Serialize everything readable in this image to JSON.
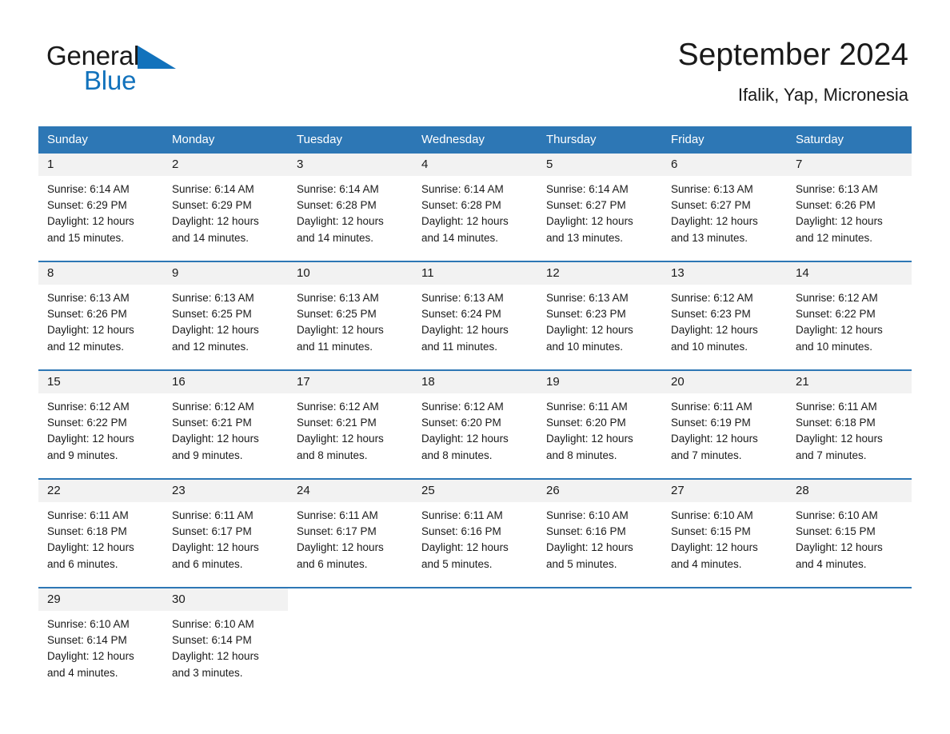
{
  "brand": {
    "name_part1": "General",
    "name_part2": "Blue",
    "logo_color": "#1272bc"
  },
  "header": {
    "title": "September 2024",
    "subtitle": "Ifalik, Yap, Micronesia"
  },
  "theme": {
    "header_blue": "#2d77b5",
    "daynum_bg": "#f2f2f2",
    "text": "#1a1a1a"
  },
  "weekday_headers": [
    "Sunday",
    "Monday",
    "Tuesday",
    "Wednesday",
    "Thursday",
    "Friday",
    "Saturday"
  ],
  "weeks": [
    [
      {
        "day": "1",
        "sunrise": "Sunrise: 6:14 AM",
        "sunset": "Sunset: 6:29 PM",
        "daylight_line1": "Daylight: 12 hours",
        "daylight_line2": "and 15 minutes."
      },
      {
        "day": "2",
        "sunrise": "Sunrise: 6:14 AM",
        "sunset": "Sunset: 6:29 PM",
        "daylight_line1": "Daylight: 12 hours",
        "daylight_line2": "and 14 minutes."
      },
      {
        "day": "3",
        "sunrise": "Sunrise: 6:14 AM",
        "sunset": "Sunset: 6:28 PM",
        "daylight_line1": "Daylight: 12 hours",
        "daylight_line2": "and 14 minutes."
      },
      {
        "day": "4",
        "sunrise": "Sunrise: 6:14 AM",
        "sunset": "Sunset: 6:28 PM",
        "daylight_line1": "Daylight: 12 hours",
        "daylight_line2": "and 14 minutes."
      },
      {
        "day": "5",
        "sunrise": "Sunrise: 6:14 AM",
        "sunset": "Sunset: 6:27 PM",
        "daylight_line1": "Daylight: 12 hours",
        "daylight_line2": "and 13 minutes."
      },
      {
        "day": "6",
        "sunrise": "Sunrise: 6:13 AM",
        "sunset": "Sunset: 6:27 PM",
        "daylight_line1": "Daylight: 12 hours",
        "daylight_line2": "and 13 minutes."
      },
      {
        "day": "7",
        "sunrise": "Sunrise: 6:13 AM",
        "sunset": "Sunset: 6:26 PM",
        "daylight_line1": "Daylight: 12 hours",
        "daylight_line2": "and 12 minutes."
      }
    ],
    [
      {
        "day": "8",
        "sunrise": "Sunrise: 6:13 AM",
        "sunset": "Sunset: 6:26 PM",
        "daylight_line1": "Daylight: 12 hours",
        "daylight_line2": "and 12 minutes."
      },
      {
        "day": "9",
        "sunrise": "Sunrise: 6:13 AM",
        "sunset": "Sunset: 6:25 PM",
        "daylight_line1": "Daylight: 12 hours",
        "daylight_line2": "and 12 minutes."
      },
      {
        "day": "10",
        "sunrise": "Sunrise: 6:13 AM",
        "sunset": "Sunset: 6:25 PM",
        "daylight_line1": "Daylight: 12 hours",
        "daylight_line2": "and 11 minutes."
      },
      {
        "day": "11",
        "sunrise": "Sunrise: 6:13 AM",
        "sunset": "Sunset: 6:24 PM",
        "daylight_line1": "Daylight: 12 hours",
        "daylight_line2": "and 11 minutes."
      },
      {
        "day": "12",
        "sunrise": "Sunrise: 6:13 AM",
        "sunset": "Sunset: 6:23 PM",
        "daylight_line1": "Daylight: 12 hours",
        "daylight_line2": "and 10 minutes."
      },
      {
        "day": "13",
        "sunrise": "Sunrise: 6:12 AM",
        "sunset": "Sunset: 6:23 PM",
        "daylight_line1": "Daylight: 12 hours",
        "daylight_line2": "and 10 minutes."
      },
      {
        "day": "14",
        "sunrise": "Sunrise: 6:12 AM",
        "sunset": "Sunset: 6:22 PM",
        "daylight_line1": "Daylight: 12 hours",
        "daylight_line2": "and 10 minutes."
      }
    ],
    [
      {
        "day": "15",
        "sunrise": "Sunrise: 6:12 AM",
        "sunset": "Sunset: 6:22 PM",
        "daylight_line1": "Daylight: 12 hours",
        "daylight_line2": "and 9 minutes."
      },
      {
        "day": "16",
        "sunrise": "Sunrise: 6:12 AM",
        "sunset": "Sunset: 6:21 PM",
        "daylight_line1": "Daylight: 12 hours",
        "daylight_line2": "and 9 minutes."
      },
      {
        "day": "17",
        "sunrise": "Sunrise: 6:12 AM",
        "sunset": "Sunset: 6:21 PM",
        "daylight_line1": "Daylight: 12 hours",
        "daylight_line2": "and 8 minutes."
      },
      {
        "day": "18",
        "sunrise": "Sunrise: 6:12 AM",
        "sunset": "Sunset: 6:20 PM",
        "daylight_line1": "Daylight: 12 hours",
        "daylight_line2": "and 8 minutes."
      },
      {
        "day": "19",
        "sunrise": "Sunrise: 6:11 AM",
        "sunset": "Sunset: 6:20 PM",
        "daylight_line1": "Daylight: 12 hours",
        "daylight_line2": "and 8 minutes."
      },
      {
        "day": "20",
        "sunrise": "Sunrise: 6:11 AM",
        "sunset": "Sunset: 6:19 PM",
        "daylight_line1": "Daylight: 12 hours",
        "daylight_line2": "and 7 minutes."
      },
      {
        "day": "21",
        "sunrise": "Sunrise: 6:11 AM",
        "sunset": "Sunset: 6:18 PM",
        "daylight_line1": "Daylight: 12 hours",
        "daylight_line2": "and 7 minutes."
      }
    ],
    [
      {
        "day": "22",
        "sunrise": "Sunrise: 6:11 AM",
        "sunset": "Sunset: 6:18 PM",
        "daylight_line1": "Daylight: 12 hours",
        "daylight_line2": "and 6 minutes."
      },
      {
        "day": "23",
        "sunrise": "Sunrise: 6:11 AM",
        "sunset": "Sunset: 6:17 PM",
        "daylight_line1": "Daylight: 12 hours",
        "daylight_line2": "and 6 minutes."
      },
      {
        "day": "24",
        "sunrise": "Sunrise: 6:11 AM",
        "sunset": "Sunset: 6:17 PM",
        "daylight_line1": "Daylight: 12 hours",
        "daylight_line2": "and 6 minutes."
      },
      {
        "day": "25",
        "sunrise": "Sunrise: 6:11 AM",
        "sunset": "Sunset: 6:16 PM",
        "daylight_line1": "Daylight: 12 hours",
        "daylight_line2": "and 5 minutes."
      },
      {
        "day": "26",
        "sunrise": "Sunrise: 6:10 AM",
        "sunset": "Sunset: 6:16 PM",
        "daylight_line1": "Daylight: 12 hours",
        "daylight_line2": "and 5 minutes."
      },
      {
        "day": "27",
        "sunrise": "Sunrise: 6:10 AM",
        "sunset": "Sunset: 6:15 PM",
        "daylight_line1": "Daylight: 12 hours",
        "daylight_line2": "and 4 minutes."
      },
      {
        "day": "28",
        "sunrise": "Sunrise: 6:10 AM",
        "sunset": "Sunset: 6:15 PM",
        "daylight_line1": "Daylight: 12 hours",
        "daylight_line2": "and 4 minutes."
      }
    ],
    [
      {
        "day": "29",
        "sunrise": "Sunrise: 6:10 AM",
        "sunset": "Sunset: 6:14 PM",
        "daylight_line1": "Daylight: 12 hours",
        "daylight_line2": "and 4 minutes."
      },
      {
        "day": "30",
        "sunrise": "Sunrise: 6:10 AM",
        "sunset": "Sunset: 6:14 PM",
        "daylight_line1": "Daylight: 12 hours",
        "daylight_line2": "and 3 minutes."
      },
      {
        "day": "",
        "sunrise": "",
        "sunset": "",
        "daylight_line1": "",
        "daylight_line2": ""
      },
      {
        "day": "",
        "sunrise": "",
        "sunset": "",
        "daylight_line1": "",
        "daylight_line2": ""
      },
      {
        "day": "",
        "sunrise": "",
        "sunset": "",
        "daylight_line1": "",
        "daylight_line2": ""
      },
      {
        "day": "",
        "sunrise": "",
        "sunset": "",
        "daylight_line1": "",
        "daylight_line2": ""
      },
      {
        "day": "",
        "sunrise": "",
        "sunset": "",
        "daylight_line1": "",
        "daylight_line2": ""
      }
    ]
  ]
}
